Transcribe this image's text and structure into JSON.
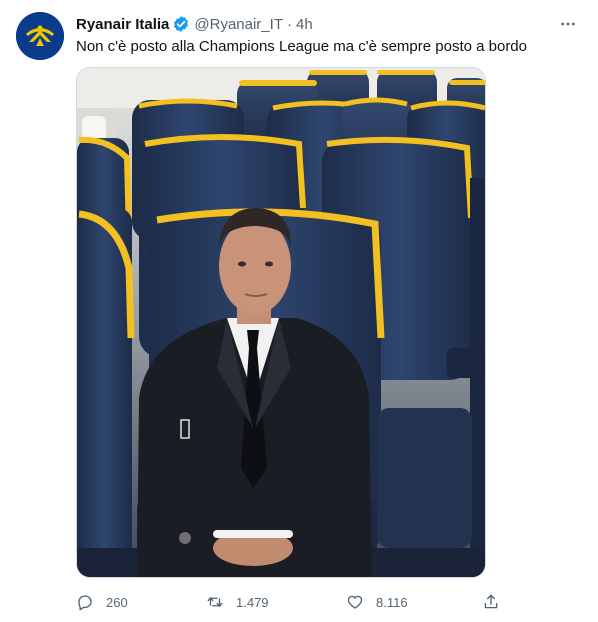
{
  "tweet": {
    "author_name": "Ryanair Italia",
    "handle": "@Ryanair_IT",
    "separator": "·",
    "time": "4h",
    "text": "Non c'è posto alla Champions League ma c'è sempre posto a bordo",
    "verified": true
  },
  "actions": {
    "replies": "260",
    "retweets": "1.479",
    "likes": "8.116"
  },
  "colors": {
    "brand_blue": "#0b3b8c",
    "brand_yellow": "#f1c400",
    "verified_blue": "#1d9bf0",
    "text_primary": "#0f1419",
    "text_secondary": "#536471",
    "seat_blue": "#253a5e",
    "seat_yellow": "#f2c020"
  },
  "icons": {
    "verified": "verified-badge-icon",
    "more": "more-dots-icon",
    "reply": "reply-icon",
    "retweet": "retweet-icon",
    "like": "heart-icon",
    "share": "share-icon"
  }
}
